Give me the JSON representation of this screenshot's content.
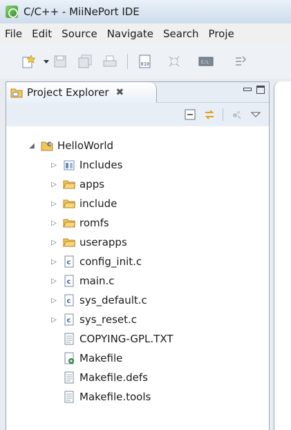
{
  "window": {
    "title": "C/C++ - MiiNePort IDE"
  },
  "menu": [
    "File",
    "Edit",
    "Source",
    "Navigate",
    "Search",
    "Proje"
  ],
  "toolbar": {
    "buttons": [
      "new-wizard-icon",
      "dropdown-arrow-icon",
      "save-icon",
      "save-all-icon",
      "print-icon",
      "binary-icon",
      "debug-icon",
      "terminal-icon",
      "build-icon"
    ]
  },
  "project_explorer": {
    "tab_label": "Project Explorer",
    "close_glyph": "✖",
    "toolbar_buttons": [
      "collapse-all-icon",
      "link-with-editor-icon",
      "filter-icon",
      "view-menu-icon"
    ],
    "tree": [
      {
        "label": "HelloWorld",
        "icon": "c-project-icon",
        "depth": 0,
        "expanded": true
      },
      {
        "label": "Includes",
        "icon": "includes-icon",
        "depth": 1,
        "expanded": false
      },
      {
        "label": "apps",
        "icon": "folder-icon",
        "depth": 1,
        "expanded": false
      },
      {
        "label": "include",
        "icon": "folder-icon",
        "depth": 1,
        "expanded": false
      },
      {
        "label": "romfs",
        "icon": "folder-icon",
        "depth": 1,
        "expanded": false
      },
      {
        "label": "userapps",
        "icon": "folder-icon",
        "depth": 1,
        "expanded": false
      },
      {
        "label": "config_init.c",
        "icon": "c-file-icon",
        "depth": 1,
        "expanded": false
      },
      {
        "label": "main.c",
        "icon": "c-file-icon",
        "depth": 1,
        "expanded": false
      },
      {
        "label": "sys_default.c",
        "icon": "c-file-icon",
        "depth": 1,
        "expanded": false
      },
      {
        "label": "sys_reset.c",
        "icon": "c-file-icon",
        "depth": 1,
        "expanded": false
      },
      {
        "label": "COPYING-GPL.TXT",
        "icon": "text-file-icon",
        "depth": 1,
        "leaf": true
      },
      {
        "label": "Makefile",
        "icon": "makefile-icon",
        "depth": 1,
        "leaf": true
      },
      {
        "label": "Makefile.defs",
        "icon": "text-file-icon",
        "depth": 1,
        "leaf": true
      },
      {
        "label": "Makefile.tools",
        "icon": "text-file-icon",
        "depth": 1,
        "leaf": true
      }
    ]
  },
  "colors": {
    "folder": "#e8b84a",
    "c_file_letter": "#3b5fb0",
    "project_icon": "#4a8fd8"
  }
}
